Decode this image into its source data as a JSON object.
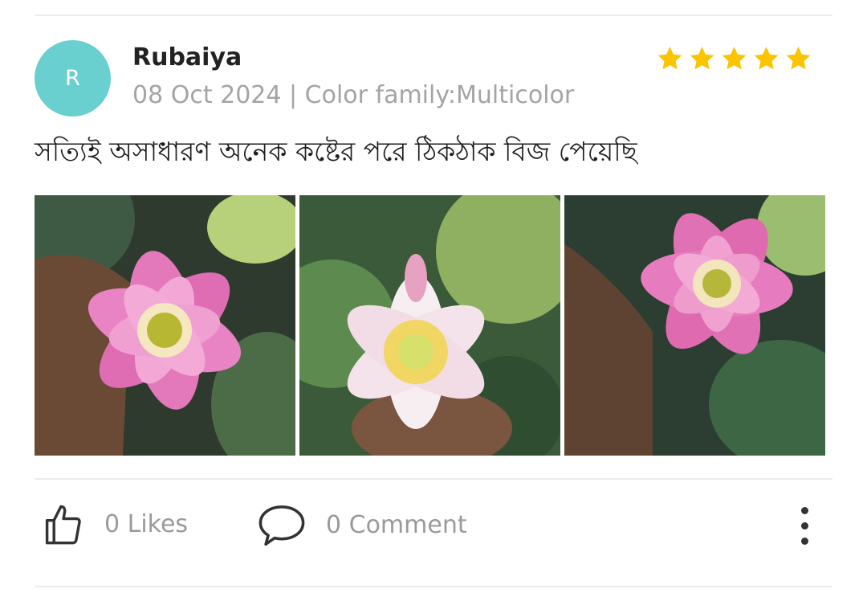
{
  "review": {
    "avatar_initial": "R",
    "reviewer_name": "Rubaiya",
    "meta": "08 Oct 2024 | Color family:Multicolor",
    "rating": 5,
    "text": "সত্যিই অসাধারণ অনেক কষ্টের পরে ঠিকঠাক বিজ পেয়েছি",
    "photos": [
      "pink-lotus-in-hand",
      "white-pink-lotus",
      "pink-lotus-in-hand-2"
    ]
  },
  "actions": {
    "likes_label": "0 Likes",
    "comments_label": "0 Comment"
  },
  "colors": {
    "avatar": "#69cfcf",
    "star": "#fbc400",
    "muted_text": "#9a9a9a"
  }
}
